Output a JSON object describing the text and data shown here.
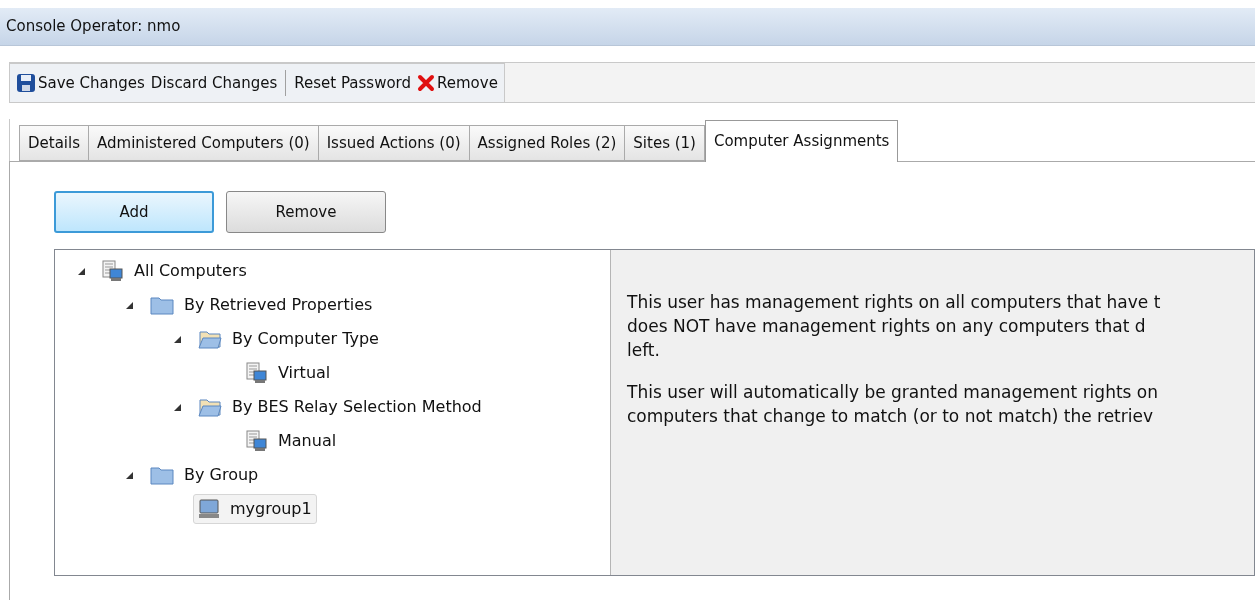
{
  "window": {
    "title": "Console Operator: nmo"
  },
  "toolbar": [
    {
      "kind": "save",
      "label": "Save Changes"
    },
    {
      "kind": "plain",
      "label": "Discard Changes"
    },
    {
      "kind": "separator"
    },
    {
      "kind": "plain",
      "label": "Reset Password"
    },
    {
      "kind": "remove",
      "label": "Remove"
    }
  ],
  "tabs": [
    {
      "label": "Details",
      "selected": false
    },
    {
      "label": "Administered Computers (0)",
      "selected": false
    },
    {
      "label": "Issued Actions (0)",
      "selected": false
    },
    {
      "label": "Assigned Roles (2)",
      "selected": false
    },
    {
      "label": "Sites (1)",
      "selected": false
    },
    {
      "label": "Computer Assignments",
      "selected": true
    }
  ],
  "buttons": [
    {
      "label": "Add",
      "selected": true
    },
    {
      "label": "Remove",
      "selected": false
    }
  ],
  "tree": [
    {
      "label": "All Computers",
      "kind": "computers",
      "expanded": true,
      "selected": false,
      "children": [
        {
          "label": "By Retrieved Properties",
          "kind": "folder",
          "expanded": true,
          "selected": false,
          "children": [
            {
              "label": "By Computer Type",
              "kind": "folder-open",
              "expanded": true,
              "selected": false,
              "children": [
                {
                  "label": "Virtual",
                  "kind": "computers",
                  "selected": false
                }
              ]
            },
            {
              "label": "By BES Relay Selection Method",
              "kind": "folder-open",
              "expanded": true,
              "selected": false,
              "children": [
                {
                  "label": "Manual",
                  "kind": "computers",
                  "selected": false
                }
              ]
            }
          ]
        },
        {
          "label": "By Group",
          "kind": "folder",
          "expanded": true,
          "selected": false,
          "children": [
            {
              "label": "mygroup1",
              "kind": "computer",
              "selected": true
            }
          ]
        }
      ]
    }
  ],
  "info": [
    [
      "This user has management rights on all computers that have t",
      "does NOT have management rights on any computers that d",
      "left."
    ],
    [
      "This user will automatically be granted management rights on",
      "computers that change to match (or to not match) the retriev"
    ]
  ]
}
